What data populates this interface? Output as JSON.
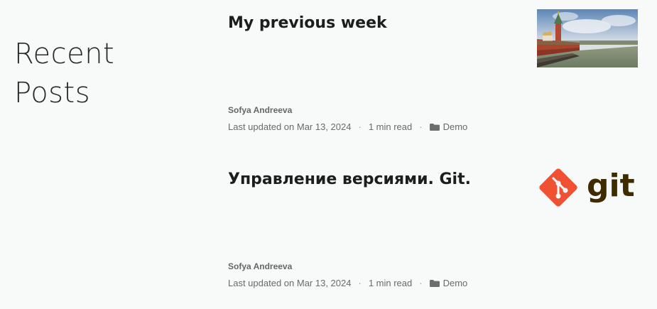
{
  "section": {
    "title_line1": "Recent",
    "title_line2": "Posts"
  },
  "posts": [
    {
      "title": "My previous week",
      "author": "Sofya Andreeva",
      "updated": "Last updated on Mar 13, 2024",
      "separator": "·",
      "read_time": "1 min read",
      "category": "Demo",
      "thumbnail": "kremlin-river-photo"
    },
    {
      "title": "Управление версиями. Git.",
      "author": "Sofya Andreeva",
      "updated": "Last updated on Mar 13, 2024",
      "separator": "·",
      "read_time": "1 min read",
      "category": "Demo",
      "thumbnail": "git-logo",
      "thumbnail_text": "git"
    }
  ],
  "colors": {
    "background": "#f7faf9",
    "title": "#1d1d1d",
    "meta": "#6a6a6a",
    "git_orange": "#f05133",
    "git_text": "#3e2c00"
  },
  "icons": {
    "category": "folder-icon"
  }
}
